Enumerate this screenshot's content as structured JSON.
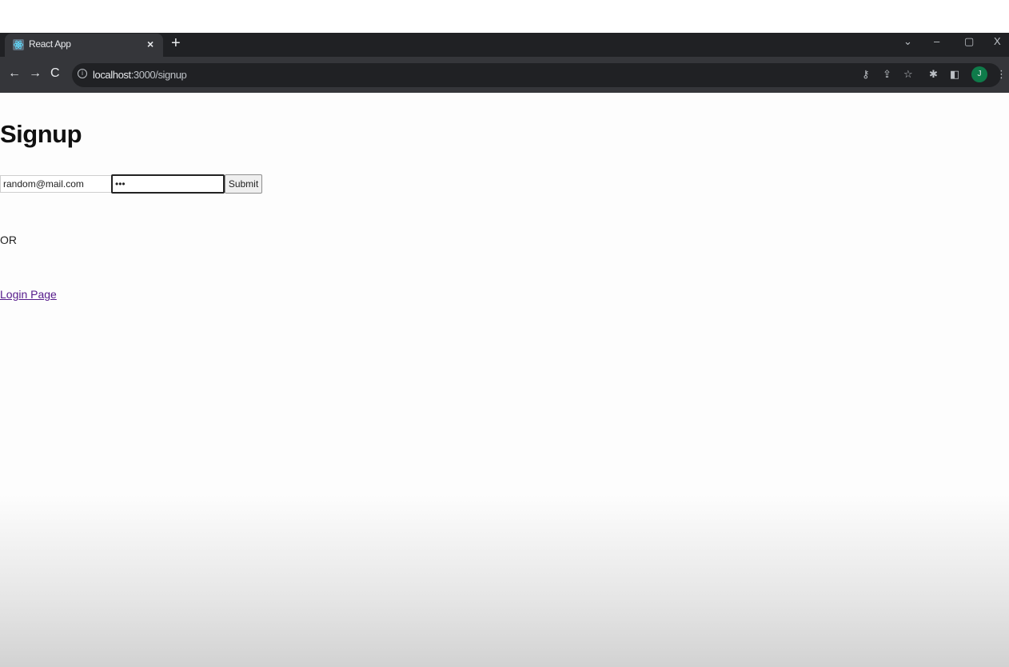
{
  "browser": {
    "tab_title": "React App",
    "tab_close": "×",
    "new_tab": "+",
    "url_host": "localhost",
    "url_rest": ":3000/signup",
    "window_controls": {
      "menu": "⌄",
      "minimize": "–",
      "restore": "▢",
      "close": "X"
    },
    "profile_initial": "J",
    "accent_color": "#0f7b4a"
  },
  "page": {
    "heading": "Signup",
    "form": {
      "email_value": "random@mail.com",
      "password_value": "abc",
      "submit_label": "Submit"
    },
    "or_text": "OR",
    "login_link": "Login Page"
  }
}
